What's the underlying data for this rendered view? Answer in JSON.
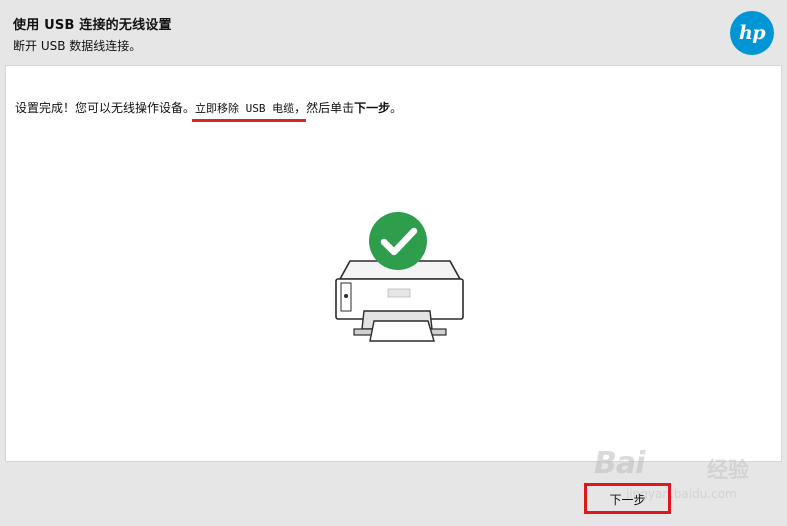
{
  "header": {
    "title": "使用 USB 连接的无线设置",
    "subtitle": "断开 USB 数据线连接。",
    "logo_text": "hp",
    "logo_color": "#0096d6"
  },
  "message": {
    "part1": "设置完成！您可以无线操作设备。",
    "part2": "立即移除 USB 电缆",
    "part3": "，然后单击",
    "part4": "下一步",
    "part5": "。"
  },
  "status": {
    "icon": "checkmark-icon",
    "color": "#2e9e4d"
  },
  "buttons": {
    "next_label": "下一步"
  },
  "watermark": {
    "main": "Bai",
    "cn": "经验",
    "url": "jingyan.baidu.com"
  },
  "colors": {
    "highlight": "#e0161e",
    "background": "#e6e6e6",
    "panel": "#ffffff"
  }
}
